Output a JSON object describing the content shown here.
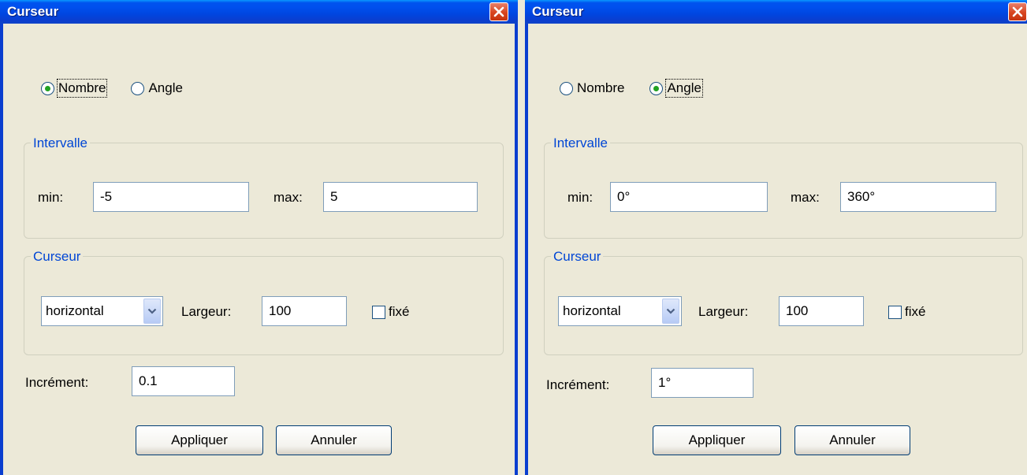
{
  "dialogs": [
    {
      "title": "Curseur",
      "type_options": {
        "nombre": "Nombre",
        "angle": "Angle",
        "selected": "nombre"
      },
      "interval": {
        "legend": "Intervalle",
        "min_label": "min:",
        "min_value": "-5",
        "max_label": "max:",
        "max_value": "5"
      },
      "slider": {
        "legend": "Curseur",
        "orientation": "horizontal",
        "width_label": "Largeur:",
        "width_value": "100",
        "fixed_label": "fixé",
        "fixed_checked": false
      },
      "increment": {
        "label": "Incrément:",
        "value": "0.1"
      },
      "buttons": {
        "apply": "Appliquer",
        "cancel": "Annuler"
      }
    },
    {
      "title": "Curseur",
      "type_options": {
        "nombre": "Nombre",
        "angle": "Angle",
        "selected": "angle"
      },
      "interval": {
        "legend": "Intervalle",
        "min_label": "min:",
        "min_value": "0°",
        "max_label": "max:",
        "max_value": "360°"
      },
      "slider": {
        "legend": "Curseur",
        "orientation": "horizontal",
        "width_label": "Largeur:",
        "width_value": "100",
        "fixed_label": "fixé",
        "fixed_checked": false
      },
      "increment": {
        "label": "Incrément:",
        "value": "1°"
      },
      "buttons": {
        "apply": "Appliquer",
        "cancel": "Annuler"
      }
    }
  ],
  "colors": {
    "titlebar": "#0053ee",
    "legend": "#0046d5",
    "background": "#ece9d8",
    "radio_dot": "#21a121"
  }
}
